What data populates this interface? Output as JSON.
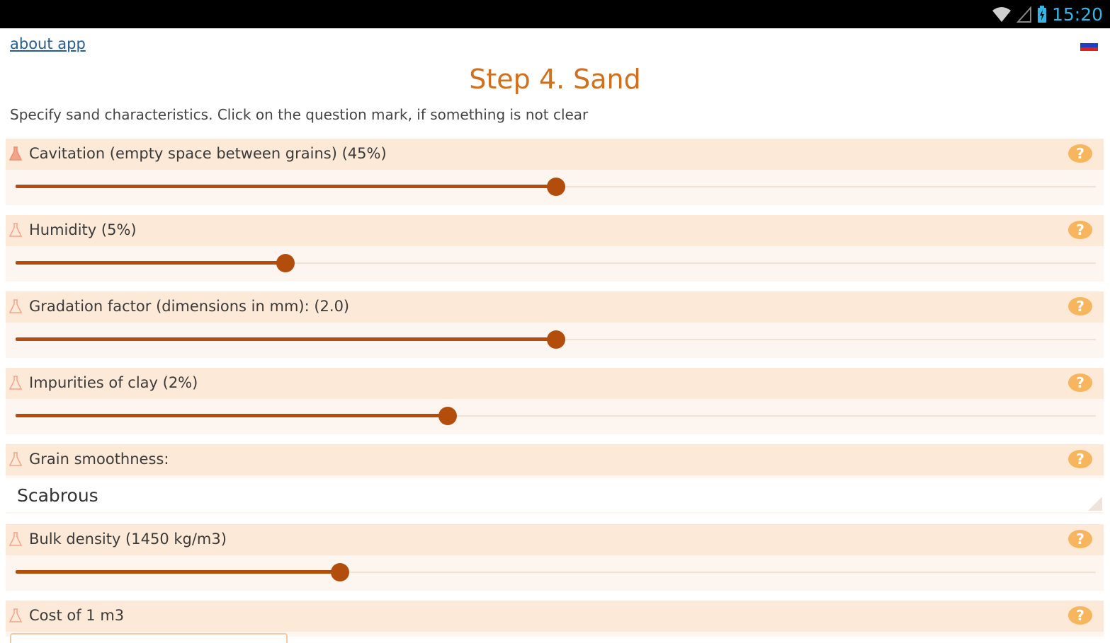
{
  "status_bar": {
    "time": "15:20"
  },
  "header": {
    "about_link": "about app",
    "title": "Step 4. Sand",
    "subtitle": "Specify sand characteristics. Click on the question mark, if something is not clear"
  },
  "fields": {
    "cavitation": {
      "label": "Cavitation (empty space between grains) (45%)",
      "fraction": 0.5
    },
    "humidity": {
      "label": "Humidity (5%)",
      "fraction": 0.25
    },
    "gradation": {
      "label": "Gradation factor (dimensions in mm): (2.0)",
      "fraction": 0.5
    },
    "clay": {
      "label": "Impurities of clay (2%)",
      "fraction": 0.4
    },
    "smoothness": {
      "label": "Grain smoothness:",
      "value": "Scabrous"
    },
    "density": {
      "label": "Bulk density (1450 kg/m3)",
      "fraction": 0.3
    },
    "cost": {
      "label": "Cost of 1 m3"
    }
  },
  "help_symbol": "?",
  "colors": {
    "accent": "#d0701f",
    "slider": "#b24d0b",
    "help_icon": "#f7b55e",
    "row_header": "#fde9d8",
    "row_body": "#fdf6f0"
  }
}
